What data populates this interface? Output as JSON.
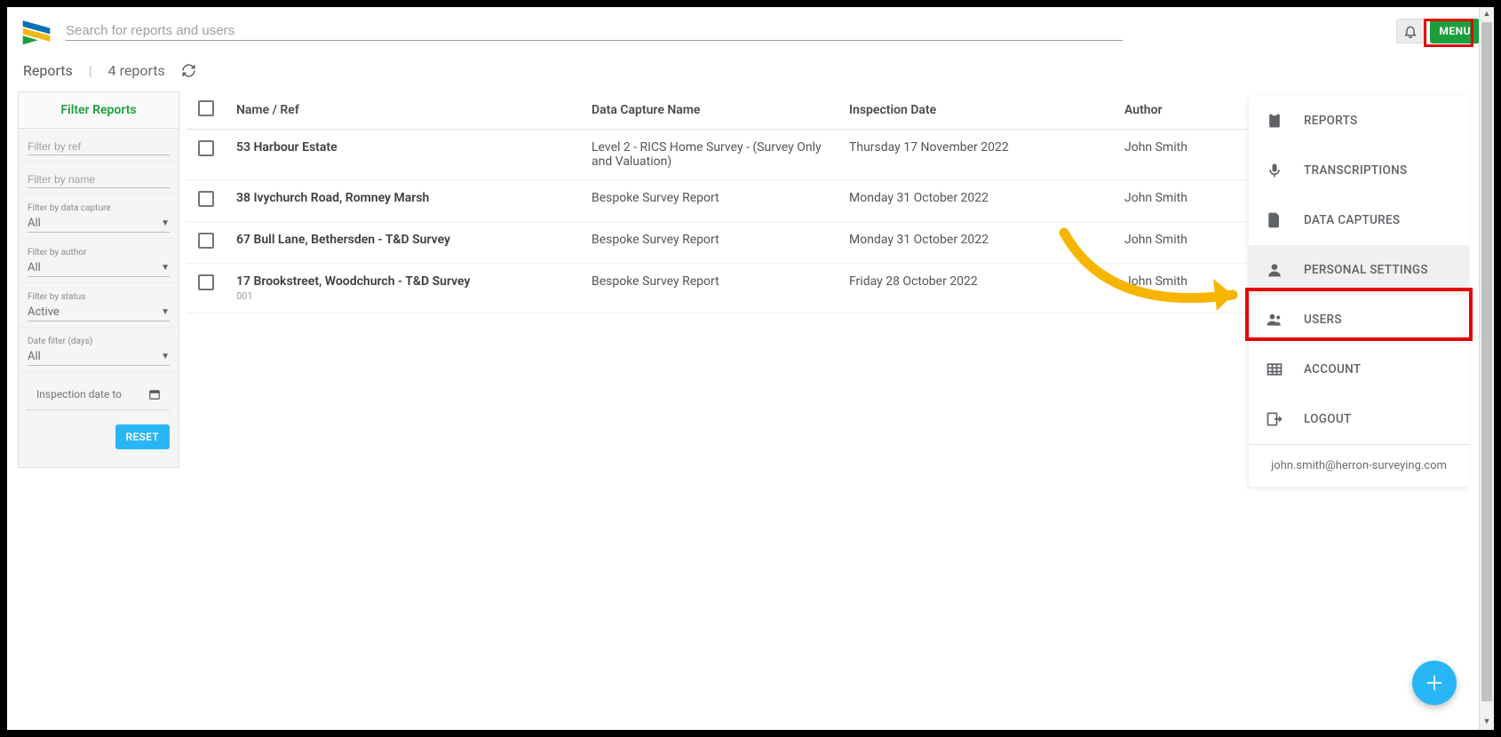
{
  "search": {
    "placeholder": "Search for reports and users"
  },
  "top": {
    "menu_label": "MENU"
  },
  "subheader": {
    "title": "Reports",
    "count_label": "4 reports"
  },
  "filters": {
    "title": "Filter Reports",
    "by_ref_ph": "Filter by ref",
    "by_name_ph": "Filter by name",
    "data_capture": {
      "label": "Filter by data capture",
      "value": "All"
    },
    "author": {
      "label": "Filter by author",
      "value": "All"
    },
    "status": {
      "label": "Filter by status",
      "value": "Active"
    },
    "date_days": {
      "label": "Date filter (days)",
      "value": "All"
    },
    "inspection_to": "Inspection date to",
    "reset_label": "RESET"
  },
  "columns": {
    "name": "Name / Ref",
    "capture": "Data Capture Name",
    "date": "Inspection Date",
    "author": "Author"
  },
  "rows": [
    {
      "name": "53 Harbour Estate",
      "ref": "",
      "capture": "Level 2 - RICS Home Survey - (Survey Only and Valuation)",
      "date": "Thursday 17 November 2022",
      "author": "John Smith"
    },
    {
      "name": "38 Ivychurch Road, Romney Marsh",
      "ref": "",
      "capture": "Bespoke Survey Report",
      "date": "Monday 31 October 2022",
      "author": "John Smith"
    },
    {
      "name": "67 Bull Lane, Bethersden - T&D Survey",
      "ref": "",
      "capture": "Bespoke Survey Report",
      "date": "Monday 31 October 2022",
      "author": "John Smith"
    },
    {
      "name": "17 Brookstreet, Woodchurch - T&D Survey",
      "ref": "001",
      "capture": "Bespoke Survey Report",
      "date": "Friday 28 October 2022",
      "author": "John Smith"
    }
  ],
  "menu": {
    "items": [
      {
        "label": "REPORTS",
        "icon": "clipboard"
      },
      {
        "label": "TRANSCRIPTIONS",
        "icon": "mic"
      },
      {
        "label": "DATA CAPTURES",
        "icon": "doc"
      },
      {
        "label": "PERSONAL SETTINGS",
        "icon": "person",
        "selected": true
      },
      {
        "label": "USERS",
        "icon": "group"
      },
      {
        "label": "ACCOUNT",
        "icon": "grid"
      },
      {
        "label": "LOGOUT",
        "icon": "logout"
      }
    ],
    "email": "john.smith@herron-surveying.com"
  }
}
